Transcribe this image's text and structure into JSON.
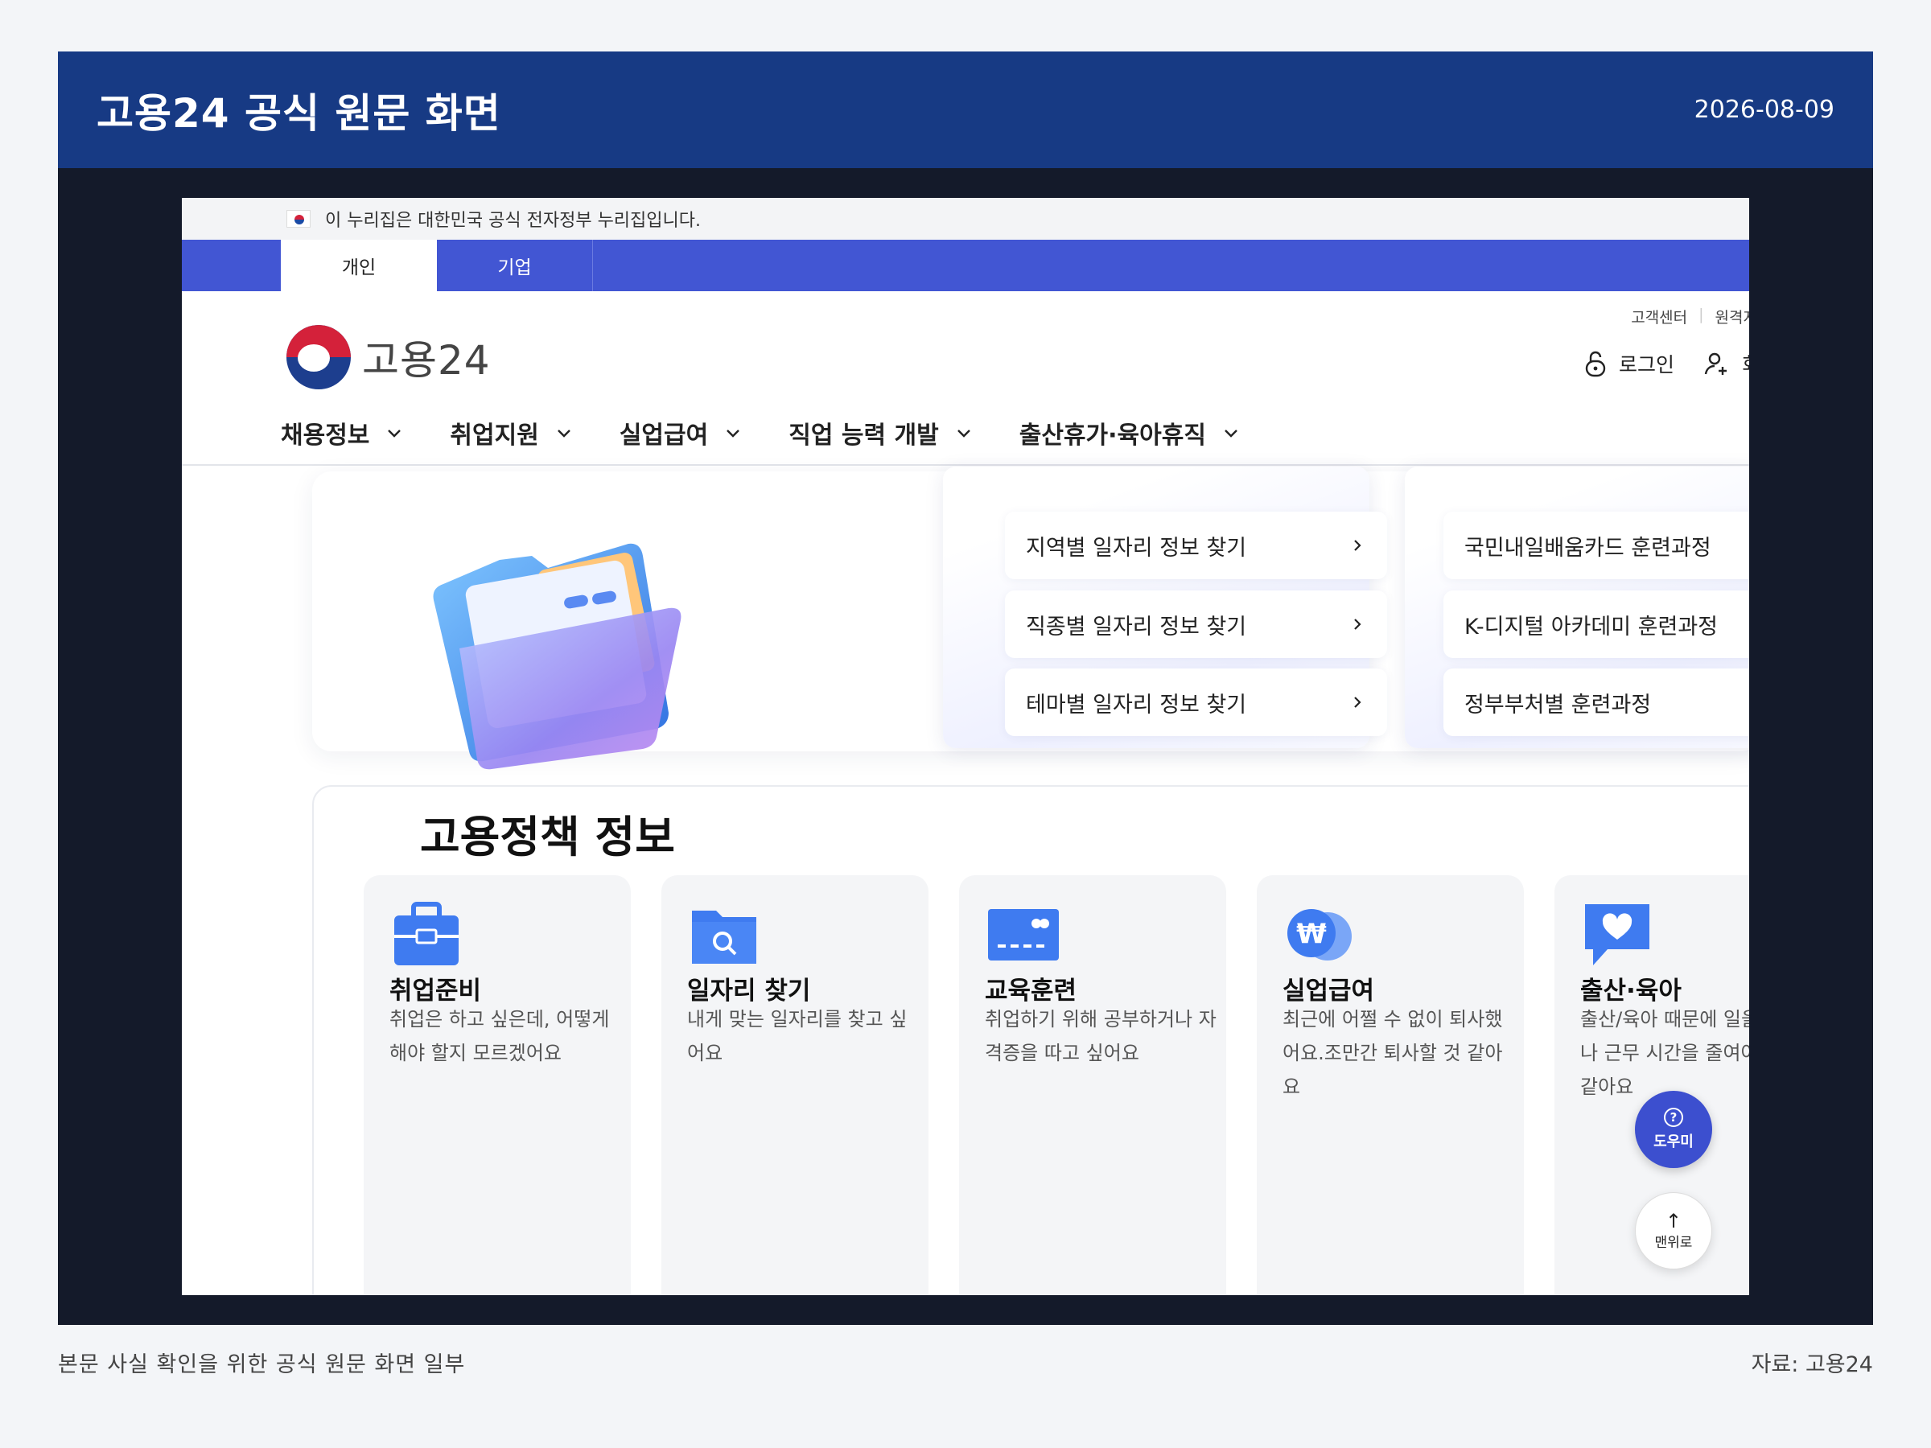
{
  "banner": {
    "title": "고용24 공식 원문 화면",
    "date": "2026-08-09"
  },
  "gov_notice": "이 누리집은 대한민국 공식 전자정부 누리집입니다.",
  "tabs": [
    {
      "label": "개인"
    },
    {
      "label": "기업"
    }
  ],
  "utility": {
    "customer_center": "고객센터",
    "remote": "원격지"
  },
  "logo_text": "고용24",
  "header": {
    "login": "로그인",
    "signup": "회"
  },
  "nav": [
    {
      "label": "채용정보"
    },
    {
      "label": "취업지원"
    },
    {
      "label": "실업급여"
    },
    {
      "label": "직업 능력 개발"
    },
    {
      "label": "출산휴가·육아휴직"
    }
  ],
  "job_links": [
    {
      "label": "지역별 일자리 정보 찾기"
    },
    {
      "label": "직종별 일자리 정보 찾기"
    },
    {
      "label": "테마별 일자리 정보 찾기"
    }
  ],
  "training_links": [
    {
      "label": "국민내일배움카드 훈련과정"
    },
    {
      "label": "K-디지털 아카데미 훈련과정"
    },
    {
      "label": "정부부처별 훈련과정"
    }
  ],
  "policy": {
    "title": "고용정책 정보",
    "cards": [
      {
        "name": "취업준비",
        "desc": "취업은 하고 싶은데, 어떻게 해야 할지 모르겠어요",
        "icon": "briefcase-icon"
      },
      {
        "name": "일자리 찾기",
        "desc": "내게 맞는 일자리를 찾고 싶어요",
        "icon": "folder-search-icon"
      },
      {
        "name": "교육훈련",
        "desc": "취업하기 위해 공부하거나 자격증을 따고 싶어요",
        "icon": "card-icon"
      },
      {
        "name": "실업급여",
        "desc": "최근에 어쩔 수 없이 퇴사했어요.조만간 퇴사할 것 같아요",
        "icon": "won-coin-icon"
      },
      {
        "name": "출산·육아",
        "desc": "출산/육아 때문에 일을 쉬거나 근무 시간을 줄여야 할 것 같아요",
        "icon": "heart-chat-icon"
      }
    ]
  },
  "fab": {
    "help": "도우미",
    "top": "맨위로"
  },
  "caption": "본문 사실 확인을 위한 공식 원문 화면 일부",
  "source": "자료: 고용24",
  "colors": {
    "banner": "#173a84",
    "tabbar": "#4256d3",
    "accent": "#3f7bf0",
    "frame": "#141a2a"
  }
}
